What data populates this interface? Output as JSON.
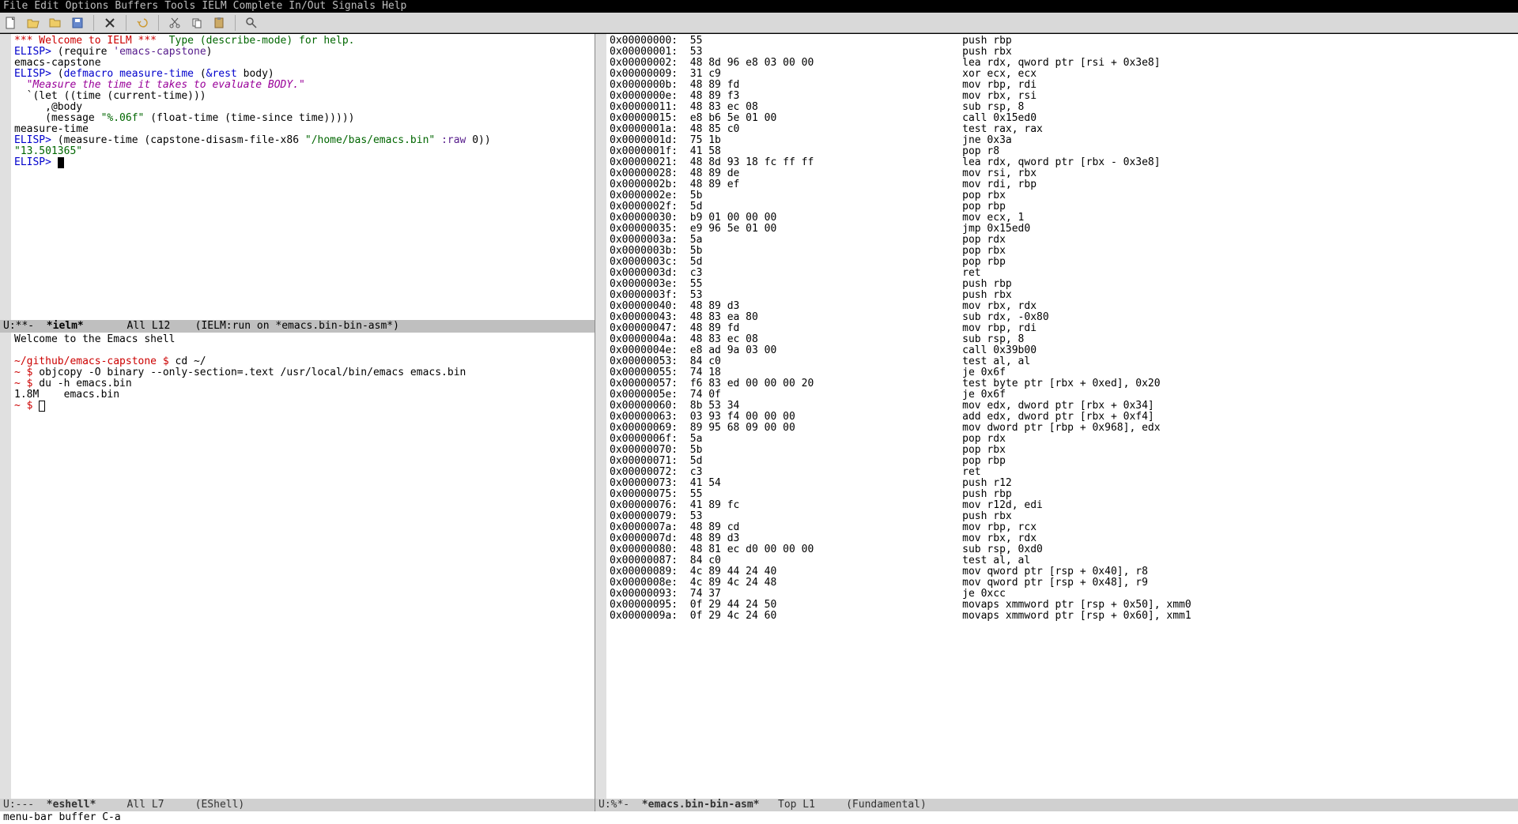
{
  "menubar": [
    "File",
    "Edit",
    "Options",
    "Buffers",
    "Tools",
    "IELM",
    "Complete",
    "In/Out",
    "Signals",
    "Help"
  ],
  "ielm": {
    "welcome": "*** Welcome to IELM ***",
    "welcome_hint": "  Type (describe-mode) for help.",
    "p1": "ELISP> ",
    "l1a": "(require ",
    "l1b": "'emacs-capstone",
    "l1c": ")",
    "r1": "emacs-capstone",
    "l2a": "(",
    "l2b": "defmacro",
    "l2c": " ",
    "l2d": "measure-time",
    "l2e": " (",
    "l2f": "&rest",
    "l2g": " body)",
    "l3": "  \"Measure the time it takes to evaluate BODY.\"",
    "l4": "  `(let ((time (current-time)))",
    "l5": "     ,@body",
    "l6a": "     (message ",
    "l6b": "\"%.06f\"",
    "l6c": " (float-time (time-since time)))))",
    "r2": "measure-time",
    "l7a": "(measure-time (capstone-disasm-file-x86 ",
    "l7b": "\"/home/bas/emacs.bin\"",
    "l7c": " ",
    "l7d": ":raw",
    "l7e": " 0))",
    "r3": "\"13.501365\""
  },
  "modeline_ielm": "U:**-  *ielm*       All L12    (IELM:run on *emacs.bin-bin-asm*)",
  "eshell": {
    "welcome": "Welcome to the Emacs shell",
    "blank": "",
    "p1a": "~/github/emacs-capstone $",
    "p1b": " cd ~/",
    "p2a": "~ $",
    "p2b": " objcopy -O binary --only-section=.text /usr/local/bin/emacs emacs.bin",
    "p3a": "~ $",
    "p3b": " du -h emacs.bin",
    "r3": "1.8M    emacs.bin",
    "p4a": "~ $",
    "p4b": " "
  },
  "modeline_eshell": "U:---  *eshell*     All L7     (EShell)",
  "modeline_asm": "U:%*-  *emacs.bin-bin-asm*   Top L1     (Fundamental)",
  "echo": "menu-bar buffer C-a",
  "disasm": [
    {
      "a": "0x00000000:",
      "b": "55",
      "m": "push rbp"
    },
    {
      "a": "0x00000001:",
      "b": "53",
      "m": "push rbx"
    },
    {
      "a": "0x00000002:",
      "b": "48 8d 96 e8 03 00 00",
      "m": "lea rdx, qword ptr [rsi + 0x3e8]"
    },
    {
      "a": "0x00000009:",
      "b": "31 c9",
      "m": "xor ecx, ecx"
    },
    {
      "a": "0x0000000b:",
      "b": "48 89 fd",
      "m": "mov rbp, rdi"
    },
    {
      "a": "0x0000000e:",
      "b": "48 89 f3",
      "m": "mov rbx, rsi"
    },
    {
      "a": "0x00000011:",
      "b": "48 83 ec 08",
      "m": "sub rsp, 8"
    },
    {
      "a": "0x00000015:",
      "b": "e8 b6 5e 01 00",
      "m": "call 0x15ed0"
    },
    {
      "a": "0x0000001a:",
      "b": "48 85 c0",
      "m": "test rax, rax"
    },
    {
      "a": "0x0000001d:",
      "b": "75 1b",
      "m": "jne 0x3a"
    },
    {
      "a": "0x0000001f:",
      "b": "41 58",
      "m": "pop r8"
    },
    {
      "a": "0x00000021:",
      "b": "48 8d 93 18 fc ff ff",
      "m": "lea rdx, qword ptr [rbx - 0x3e8]"
    },
    {
      "a": "0x00000028:",
      "b": "48 89 de",
      "m": "mov rsi, rbx"
    },
    {
      "a": "0x0000002b:",
      "b": "48 89 ef",
      "m": "mov rdi, rbp"
    },
    {
      "a": "0x0000002e:",
      "b": "5b",
      "m": "pop rbx"
    },
    {
      "a": "0x0000002f:",
      "b": "5d",
      "m": "pop rbp"
    },
    {
      "a": "0x00000030:",
      "b": "b9 01 00 00 00",
      "m": "mov ecx, 1"
    },
    {
      "a": "0x00000035:",
      "b": "e9 96 5e 01 00",
      "m": "jmp 0x15ed0"
    },
    {
      "a": "0x0000003a:",
      "b": "5a",
      "m": "pop rdx"
    },
    {
      "a": "0x0000003b:",
      "b": "5b",
      "m": "pop rbx"
    },
    {
      "a": "0x0000003c:",
      "b": "5d",
      "m": "pop rbp"
    },
    {
      "a": "0x0000003d:",
      "b": "c3",
      "m": "ret "
    },
    {
      "a": "0x0000003e:",
      "b": "55",
      "m": "push rbp"
    },
    {
      "a": "0x0000003f:",
      "b": "53",
      "m": "push rbx"
    },
    {
      "a": "0x00000040:",
      "b": "48 89 d3",
      "m": "mov rbx, rdx"
    },
    {
      "a": "0x00000043:",
      "b": "48 83 ea 80",
      "m": "sub rdx, -0x80"
    },
    {
      "a": "0x00000047:",
      "b": "48 89 fd",
      "m": "mov rbp, rdi"
    },
    {
      "a": "0x0000004a:",
      "b": "48 83 ec 08",
      "m": "sub rsp, 8"
    },
    {
      "a": "0x0000004e:",
      "b": "e8 ad 9a 03 00",
      "m": "call 0x39b00"
    },
    {
      "a": "0x00000053:",
      "b": "84 c0",
      "m": "test al, al"
    },
    {
      "a": "0x00000055:",
      "b": "74 18",
      "m": "je 0x6f"
    },
    {
      "a": "0x00000057:",
      "b": "f6 83 ed 00 00 00 20",
      "m": "test byte ptr [rbx + 0xed], 0x20"
    },
    {
      "a": "0x0000005e:",
      "b": "74 0f",
      "m": "je 0x6f"
    },
    {
      "a": "0x00000060:",
      "b": "8b 53 34",
      "m": "mov edx, dword ptr [rbx + 0x34]"
    },
    {
      "a": "0x00000063:",
      "b": "03 93 f4 00 00 00",
      "m": "add edx, dword ptr [rbx + 0xf4]"
    },
    {
      "a": "0x00000069:",
      "b": "89 95 68 09 00 00",
      "m": "mov dword ptr [rbp + 0x968], edx"
    },
    {
      "a": "0x0000006f:",
      "b": "5a",
      "m": "pop rdx"
    },
    {
      "a": "0x00000070:",
      "b": "5b",
      "m": "pop rbx"
    },
    {
      "a": "0x00000071:",
      "b": "5d",
      "m": "pop rbp"
    },
    {
      "a": "0x00000072:",
      "b": "c3",
      "m": "ret "
    },
    {
      "a": "0x00000073:",
      "b": "41 54",
      "m": "push r12"
    },
    {
      "a": "0x00000075:",
      "b": "55",
      "m": "push rbp"
    },
    {
      "a": "0x00000076:",
      "b": "41 89 fc",
      "m": "mov r12d, edi"
    },
    {
      "a": "0x00000079:",
      "b": "53",
      "m": "push rbx"
    },
    {
      "a": "0x0000007a:",
      "b": "48 89 cd",
      "m": "mov rbp, rcx"
    },
    {
      "a": "0x0000007d:",
      "b": "48 89 d3",
      "m": "mov rbx, rdx"
    },
    {
      "a": "0x00000080:",
      "b": "48 81 ec d0 00 00 00",
      "m": "sub rsp, 0xd0"
    },
    {
      "a": "0x00000087:",
      "b": "84 c0",
      "m": "test al, al"
    },
    {
      "a": "0x00000089:",
      "b": "4c 89 44 24 40",
      "m": "mov qword ptr [rsp + 0x40], r8"
    },
    {
      "a": "0x0000008e:",
      "b": "4c 89 4c 24 48",
      "m": "mov qword ptr [rsp + 0x48], r9"
    },
    {
      "a": "0x00000093:",
      "b": "74 37",
      "m": "je 0xcc"
    },
    {
      "a": "0x00000095:",
      "b": "0f 29 44 24 50",
      "m": "movaps xmmword ptr [rsp + 0x50], xmm0"
    },
    {
      "a": "0x0000009a:",
      "b": "0f 29 4c 24 60",
      "m": "movaps xmmword ptr [rsp + 0x60], xmm1"
    }
  ]
}
